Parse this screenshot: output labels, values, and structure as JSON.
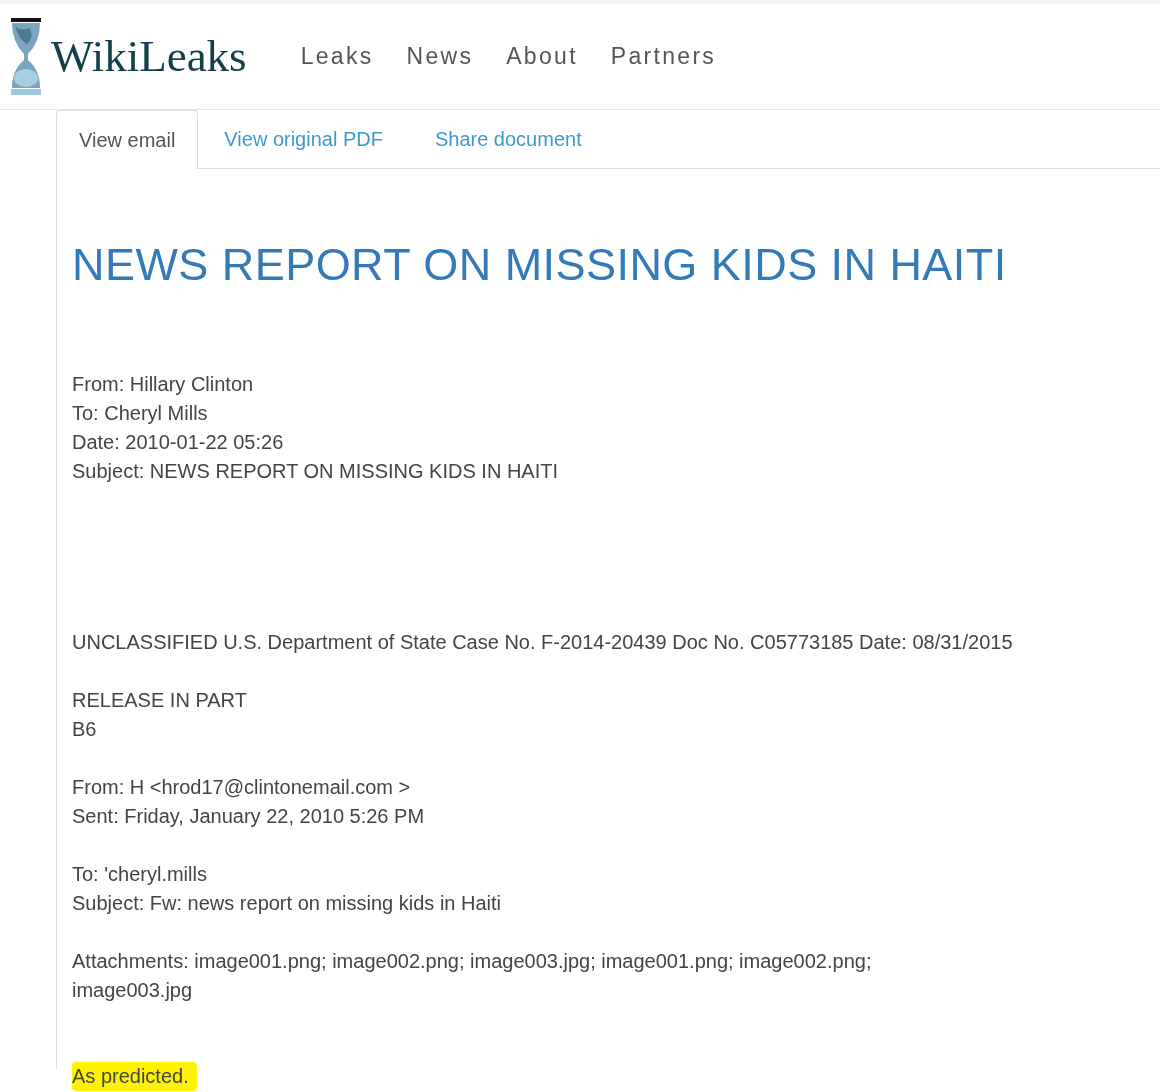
{
  "header": {
    "logo_text": "WikiLeaks",
    "nav": [
      "Leaks",
      "News",
      "About",
      "Partners"
    ]
  },
  "tabs": [
    {
      "label": "View email",
      "selected": true
    },
    {
      "label": "View original PDF",
      "selected": false
    },
    {
      "label": "Share document",
      "selected": false
    }
  ],
  "email": {
    "title": "NEWS REPORT ON MISSING KIDS IN HAITI",
    "fields": [
      "From: Hillary Clinton",
      "To: Cheryl Mills",
      "Date: 2010-01-22 05:26",
      "Subject: NEWS REPORT ON MISSING KIDS IN HAITI"
    ],
    "body": [
      {
        "lines": [
          "UNCLASSIFIED U.S. Department of State Case No. F-2014-20439 Doc No. C05773185 Date: 08/31/2015"
        ],
        "highlighted": false
      },
      {
        "lines": [
          "RELEASE IN PART",
          "B6"
        ],
        "highlighted": false
      },
      {
        "lines": [
          "From: H <hrod17@clintonemail.com >",
          "Sent: Friday, January 22, 2010 5:26 PM"
        ],
        "highlighted": false
      },
      {
        "lines": [
          "To: 'cheryl.mills",
          "Subject: Fw: news report on missing kids in Haiti"
        ],
        "highlighted": false
      },
      {
        "lines": [
          "Attachments: image001.png; image002.png; image003.jpg; image001.png; image002.png;",
          "image003.jpg"
        ],
        "highlighted": false
      },
      {
        "lines": [
          "As predicted."
        ],
        "highlighted": true
      }
    ]
  }
}
